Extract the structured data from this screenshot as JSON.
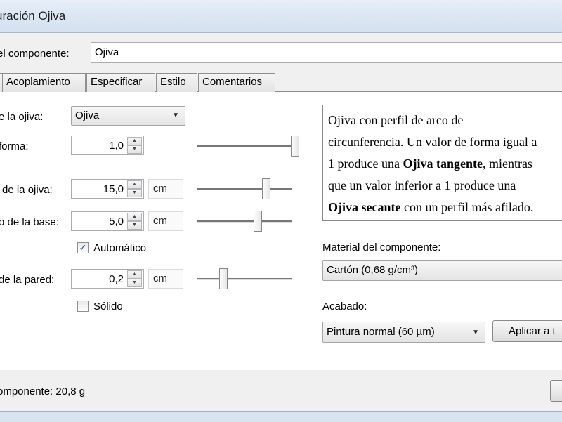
{
  "window": {
    "title": "uración Ojiva"
  },
  "header": {
    "component_label": "el componente:",
    "component_value": "Ojiva"
  },
  "tabs": [
    {
      "label": "Acoplamiento"
    },
    {
      "label": "Especificar"
    },
    {
      "label": "Estilo"
    },
    {
      "label": "Comentarios"
    }
  ],
  "fields": {
    "shape_label": "e la ojiva:",
    "shape_value": "Ojiva",
    "forma_label": "forma:",
    "forma_value": "1,0",
    "forma_slider": 1.0,
    "length_label": "de la ojiva:",
    "length_value": "15,0",
    "length_unit": "cm",
    "length_slider": 0.75,
    "base_label": "o de la base:",
    "base_value": "5,0",
    "base_unit": "cm",
    "base_slider": 0.65,
    "auto_label": "Automático",
    "auto_checked": true,
    "wall_label": "de la pared:",
    "wall_value": "0,2",
    "wall_unit": "cm",
    "wall_slider": 0.25,
    "solid_label": "Sólido",
    "solid_checked": false
  },
  "description": {
    "lines": [
      [
        {
          "t": "Ojiva con perfil de arco de"
        }
      ],
      [
        {
          "t": "circunferencia. Un valor de forma igual a"
        }
      ],
      [
        {
          "t": "1 produce una "
        },
        {
          "t": "Ojiva tangente",
          "b": true
        },
        {
          "t": ", mientras"
        }
      ],
      [
        {
          "t": "que un valor inferior a 1 produce una"
        }
      ],
      [
        {
          "t": "Ojiva secante",
          "b": true
        },
        {
          "t": " con un perfil más afilado."
        }
      ]
    ]
  },
  "material": {
    "label": "Material del componente:",
    "value": "Cartón (0,68 g/cm³)"
  },
  "finish": {
    "label": "Acabado:",
    "value": "Pintura normal (60 µm)",
    "apply_button": "Aplicar a t"
  },
  "footer": {
    "mass": "omponente: 20,8 g"
  }
}
